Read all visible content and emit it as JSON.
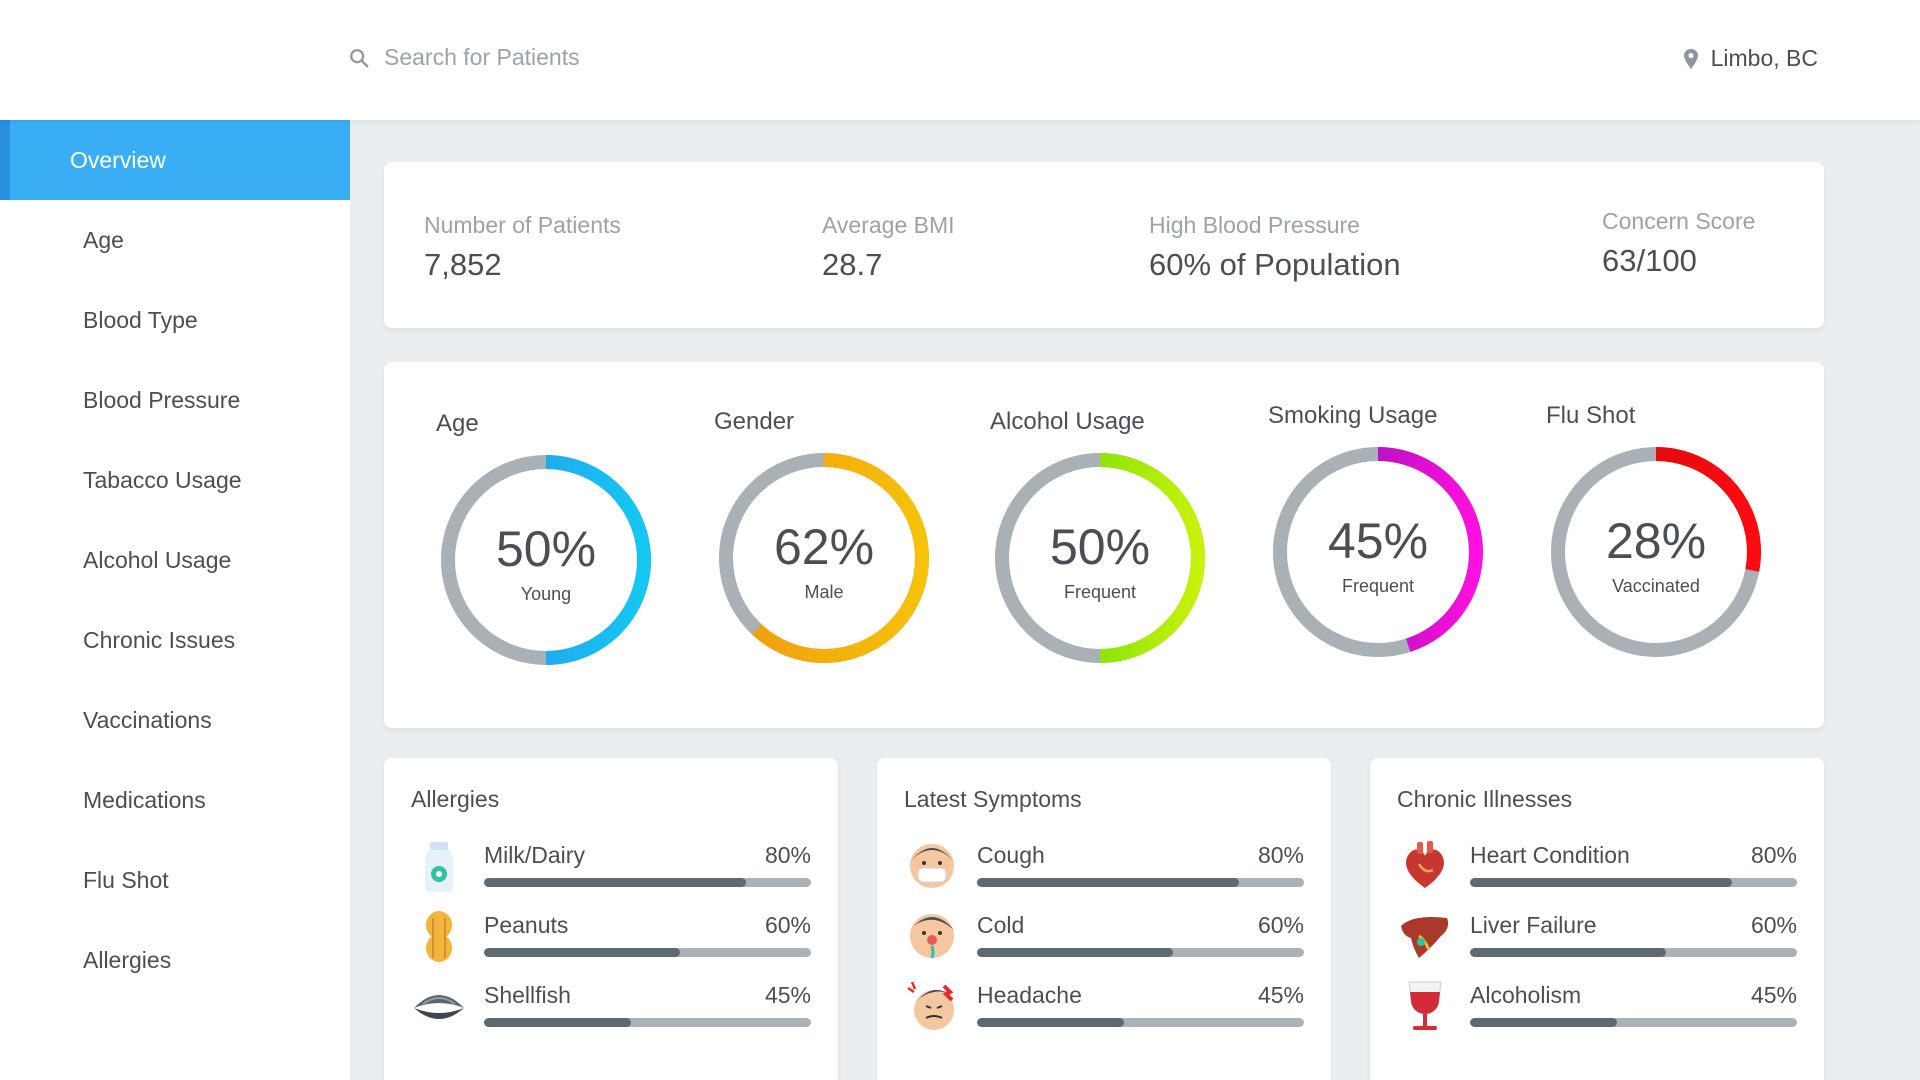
{
  "header": {
    "search_placeholder": "Search for Patients",
    "location": "Limbo, BC"
  },
  "sidebar": {
    "items": [
      {
        "label": "Overview",
        "active": true
      },
      {
        "label": "Age"
      },
      {
        "label": "Blood Type"
      },
      {
        "label": "Blood Pressure"
      },
      {
        "label": "Tabacco Usage"
      },
      {
        "label": "Alcohol Usage"
      },
      {
        "label": "Chronic Issues"
      },
      {
        "label": "Vaccinations"
      },
      {
        "label": "Medications"
      },
      {
        "label": "Flu Shot"
      },
      {
        "label": "Allergies"
      }
    ]
  },
  "stats": [
    {
      "label": "Number of Patients",
      "value": "7,852"
    },
    {
      "label": "Average BMI",
      "value": "28.7"
    },
    {
      "label": "High Blood Pressure",
      "value": "60% of Population"
    },
    {
      "label": "Concern Score",
      "value": "63/100"
    }
  ],
  "rings": [
    {
      "title": "Age",
      "percent_text": "50%",
      "caption": "Young",
      "fraction": 0.5,
      "colors": [
        "#2c8ff0",
        "#14c8f2"
      ],
      "track": "#a9b0b6"
    },
    {
      "title": "Gender",
      "percent_text": "62%",
      "caption": "Male",
      "fraction": 0.62,
      "colors": [
        "#f09a10",
        "#f6c20a"
      ],
      "track": "#a9b0b6"
    },
    {
      "title": "Alcohol Usage",
      "percent_text": "50%",
      "caption": "Frequent",
      "fraction": 0.5,
      "colors": [
        "#52d80a",
        "#c8f20a"
      ],
      "track": "#a9b0b6"
    },
    {
      "title": "Smoking Usage",
      "percent_text": "45%",
      "caption": "Frequent",
      "fraction": 0.45,
      "colors": [
        "#7a12a8",
        "#ff10e0"
      ],
      "track": "#a9b0b6"
    },
    {
      "title": "Flu Shot",
      "percent_text": "28%",
      "caption": "Vaccinated",
      "fraction": 0.28,
      "colors": [
        "#c80a0a",
        "#ff0a10"
      ],
      "track": "#a9b0b6"
    }
  ],
  "lists": [
    {
      "title": "Allergies",
      "items": [
        {
          "name": "Milk/Dairy",
          "pct": "80%",
          "value": 0.8,
          "icon": "milk-bottle-icon"
        },
        {
          "name": "Peanuts",
          "pct": "60%",
          "value": 0.6,
          "icon": "peanut-icon"
        },
        {
          "name": "Shellfish",
          "pct": "45%",
          "value": 0.45,
          "icon": "clam-shell-icon"
        }
      ]
    },
    {
      "title": "Latest Symptoms",
      "items": [
        {
          "name": "Cough",
          "pct": "80%",
          "value": 0.8,
          "icon": "masked-face-icon"
        },
        {
          "name": "Cold",
          "pct": "60%",
          "value": 0.6,
          "icon": "sick-face-icon"
        },
        {
          "name": "Headache",
          "pct": "45%",
          "value": 0.45,
          "icon": "headache-face-icon"
        }
      ]
    },
    {
      "title": "Chronic Illnesses",
      "items": [
        {
          "name": "Heart Condition",
          "pct": "80%",
          "value": 0.8,
          "icon": "heart-organ-icon"
        },
        {
          "name": "Liver Failure",
          "pct": "60%",
          "value": 0.6,
          "icon": "liver-icon"
        },
        {
          "name": "Alcoholism",
          "pct": "45%",
          "value": 0.45,
          "icon": "wine-glass-icon"
        }
      ]
    }
  ]
}
